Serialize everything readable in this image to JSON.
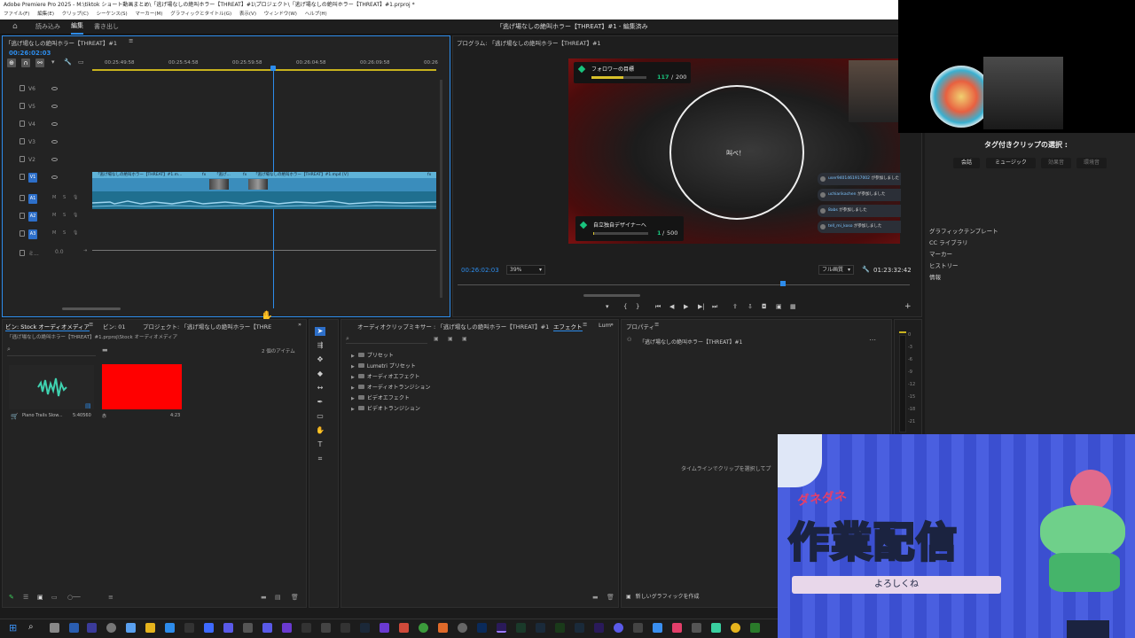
{
  "window": {
    "title": "Adobe Premiere Pro 2025 - M:\\tiktok ショート動画まとめ\\「逃げ場なしの絶叫ホラー【THREAT】#1\\プロジェクト\\「逃げ場なしの絶叫ホラー【THREAT】#1.prproj *"
  },
  "menu": [
    "ファイル(F)",
    "編集(E)",
    "クリップ(C)",
    "シーケンス(S)",
    "マーカー(M)",
    "グラフィックとタイトル(G)",
    "表示(V)",
    "ウィンドウ(W)",
    "ヘルプ(H)"
  ],
  "workspace": {
    "tabs": [
      "読み込み",
      "編集",
      "書き出し"
    ],
    "active": "編集",
    "doc_title": "「逃げ場なしの絶叫ホラー【THREAT】#1 - 編集済み"
  },
  "timeline": {
    "title": "「逃げ場なしの絶叫ホラー【THREAT】#1",
    "timecode": "00:26:02:03",
    "ruler": [
      "00:25:49:58",
      "00:25:54:58",
      "00:25:59:58",
      "00:26:04:58",
      "00:26:09:58",
      "00:26"
    ],
    "video_tracks": [
      "V6",
      "V5",
      "V4",
      "V3",
      "V2",
      "V1"
    ],
    "audio_tracks": [
      "A1",
      "A2",
      "A3"
    ],
    "master": {
      "label": "ミ...",
      "value": "0.0"
    },
    "clip_labels": [
      "「逃げ場なしの絶叫ホラー【THREAT】#1.m...",
      "「逃げ...",
      "「逃げ場なしの絶叫ホラー【THREAT】#1.mp4 [V]"
    ],
    "fx": "fx",
    "m": "M",
    "s": "S"
  },
  "program": {
    "title": "プログラム: 「逃げ場なしの絶叫ホラー【THREAT】#1",
    "timecode": "00:26:02:03",
    "zoom": "39%",
    "quality": "フル画質",
    "duration": "01:23:32:42",
    "overlay": {
      "follower_goal_label": "フォロワーの目標",
      "follower_current": "117",
      "follower_target": "200",
      "follower_progress": 0.585,
      "center_text": "叫べ！",
      "designer_label": "自立独自デザイナーへ",
      "designer_current": "1",
      "designer_target": "500",
      "designer_progress": 0.002,
      "chat": [
        {
          "user": "user9401461917002",
          "msg": "が参加しました"
        },
        {
          "user": "uchiarikachen",
          "msg": "が参加しました"
        },
        {
          "user": "8abs",
          "msg": "が参加しました"
        },
        {
          "user": "tell_mi_koso",
          "msg": "が参加しました"
        }
      ]
    }
  },
  "bin": {
    "tabs": [
      "ビン: Stock オーディオメディア",
      "ビン: 01",
      "プロジェクト: 「逃げ場なしの絶叫ホラー【THRE"
    ],
    "path": "「逃げ場なしの絶叫ホラー【THREAT】#1.prproj\\Stock オーディオメディア",
    "count": "2 個のアイテム",
    "items": [
      {
        "name": "Piano Trails Slow...",
        "duration": "5:40560",
        "type": "audio"
      },
      {
        "name": "赤",
        "duration": "4:23",
        "type": "color",
        "color": "#ff0000"
      }
    ]
  },
  "effects": {
    "tabs": [
      "オーディオクリップミキサー : 「逃げ場なしの絶叫ホラー【THREAT】#1",
      "エフェクト",
      "Lum"
    ],
    "folders": [
      "プリセット",
      "Lumetri プリセット",
      "オーディオエフェクト",
      "オーディオトランジション",
      "ビデオエフェクト",
      "ビデオトランジション"
    ]
  },
  "properties": {
    "title": "プロパティ",
    "sequence": "「逃げ場なしの絶叫ホラー【THREAT】#1",
    "empty_msg": "タイムラインでクリップを選択してプ",
    "new_graphic": "新しいグラフィックを作成"
  },
  "meter": {
    "scale": [
      "0",
      "-3",
      "-6",
      "-9",
      "-12",
      "-15",
      "-18",
      "-21"
    ]
  },
  "right_panel": {
    "tag_title": "タグ付きクリップの選択 :",
    "tags": [
      "会話",
      "ミュージック",
      "効果音",
      "環境音"
    ],
    "menu": [
      "グラフィックテンプレート",
      "CC ライブラリ",
      "マーカー",
      "ヒストリー",
      "情報"
    ]
  },
  "stream_overlay": {
    "kana": "ダネダネ",
    "main": "作業配信",
    "sub": "よろしくね",
    "accent": "#3b4fd0"
  }
}
